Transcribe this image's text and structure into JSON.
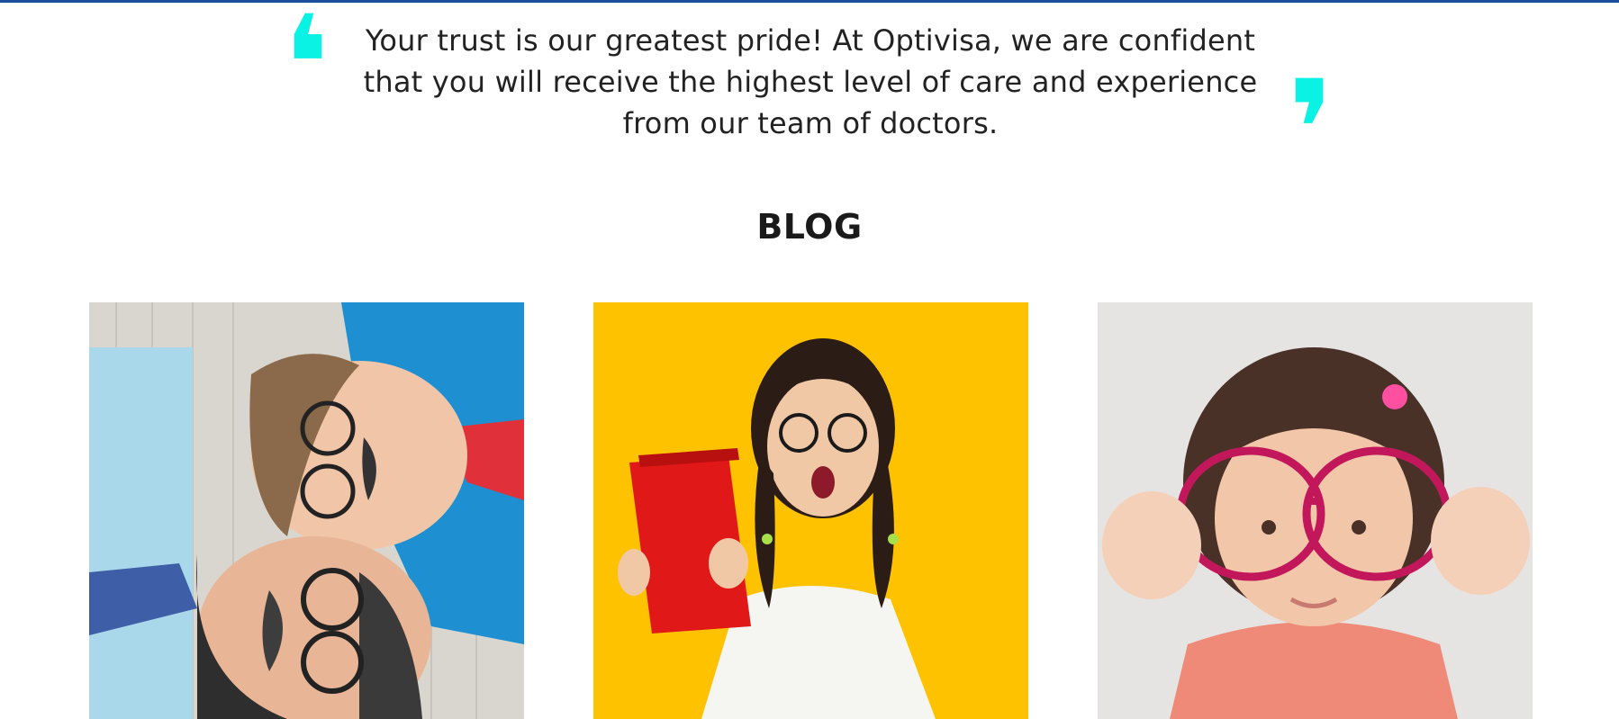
{
  "testimonial": {
    "text": "Your trust is our greatest pride! At Optivisa, we are confident that you will receive the highest level of care and experience from our team of doctors.",
    "open_mark": "❛",
    "close_mark": "❜"
  },
  "blog": {
    "title": "BLOG",
    "cards": [
      {
        "image": "father-and-son-with-glasses-and-mustache-props"
      },
      {
        "image": "girl-with-glasses-holding-red-book"
      },
      {
        "image": "girl-holding-pink-glasses"
      }
    ]
  },
  "colors": {
    "accent_quote": "#0af2e3",
    "top_rule": "#1d4e9e",
    "card2_background": "#ffc200"
  }
}
